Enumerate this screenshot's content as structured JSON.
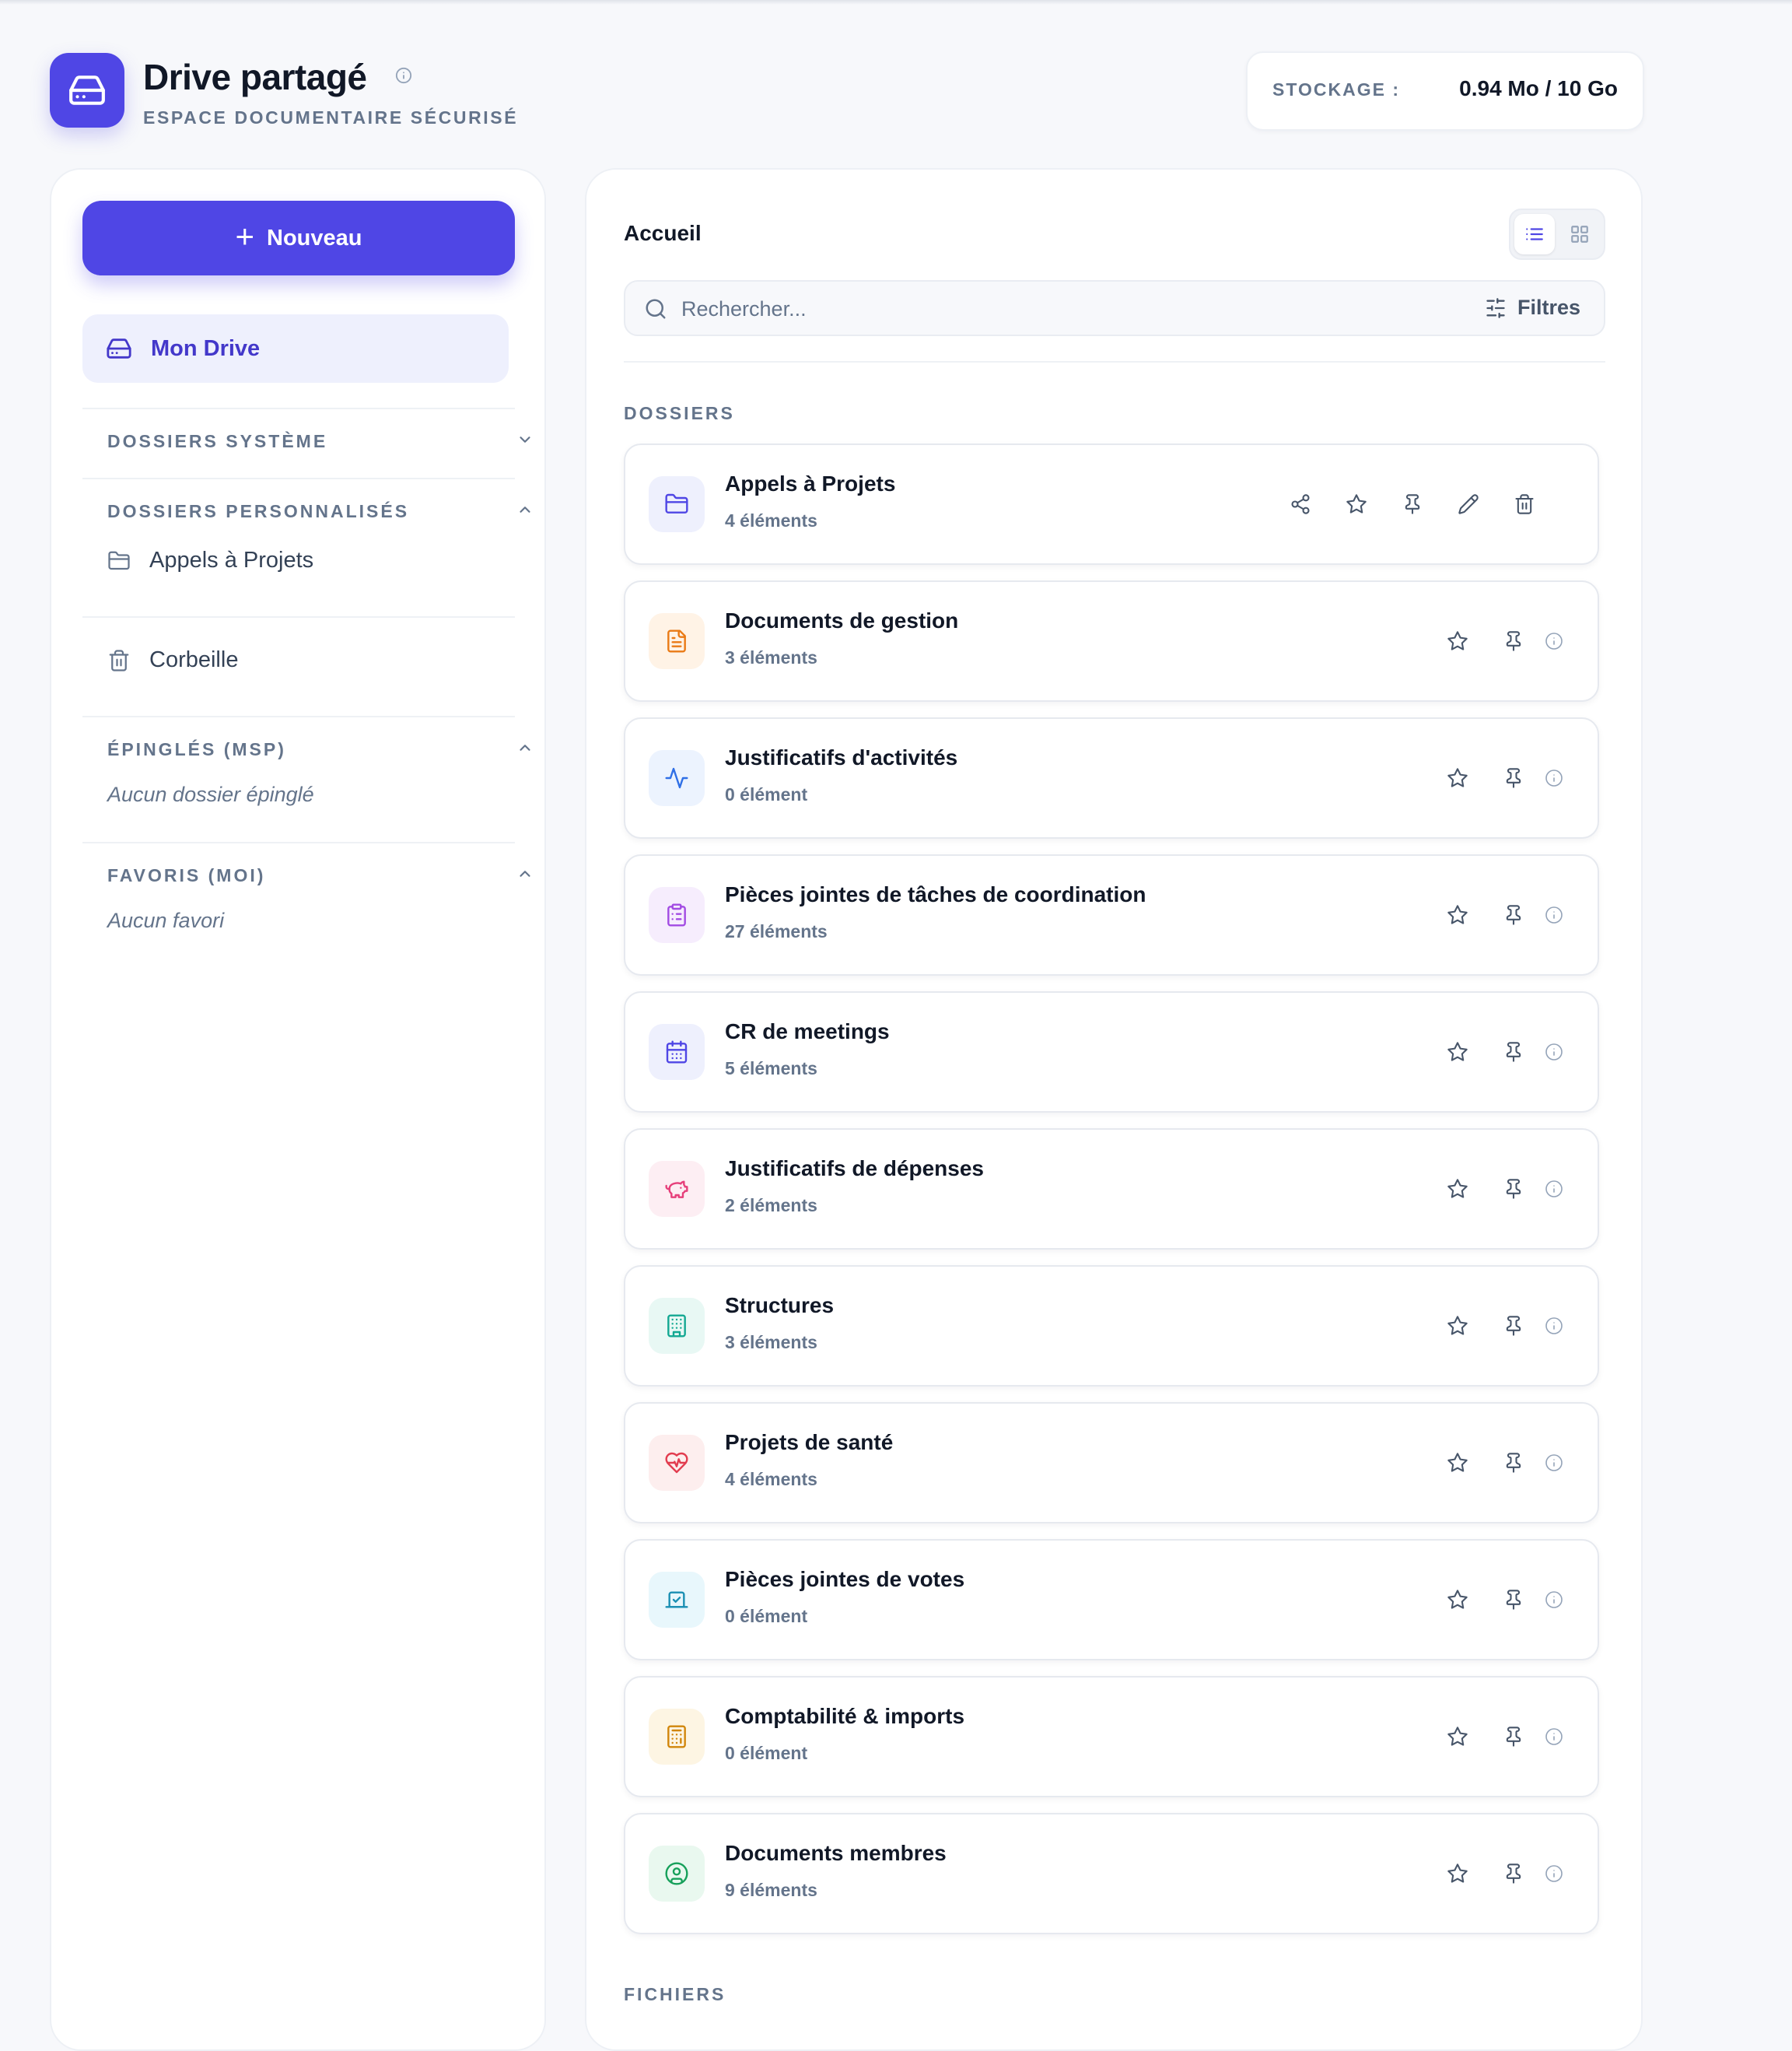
{
  "header": {
    "title": "Drive partagé",
    "subtitle": "ESPACE DOCUMENTAIRE SÉCURISÉ",
    "storage_label": "STOCKAGE :",
    "storage_value": "0.94 Mo / 10 Go"
  },
  "sidebar": {
    "new_button": "Nouveau",
    "my_drive": "Mon Drive",
    "system_folders": "DOSSIERS SYSTÈME",
    "custom_folders": "DOSSIERS PERSONNALISÉS",
    "custom_items": [
      "Appels à Projets"
    ],
    "trash": "Corbeille",
    "pinned_header": "ÉPINGLÉS (MSP)",
    "pinned_empty": "Aucun dossier épinglé",
    "favorites_header": "FAVORIS (MOI)",
    "favorites_empty": "Aucun favori"
  },
  "main": {
    "breadcrumb": "Accueil",
    "search_placeholder": "Rechercher...",
    "filters_label": "Filtres",
    "folders_header": "DOSSIERS",
    "files_header": "FICHIERS",
    "folders": [
      {
        "name": "Appels à Projets",
        "count": "4 éléments",
        "icon": "folder-icon",
        "color": "#4f46e5",
        "bg": "#eef0fd",
        "actions": [
          "share-icon",
          "star-icon",
          "pin-icon",
          "edit-icon",
          "trash-icon"
        ]
      },
      {
        "name": "Documents de gestion",
        "count": "3 éléments",
        "icon": "document-icon",
        "color": "#ea7a15",
        "bg": "#fff3e6",
        "actions": [
          "star-icon",
          "pin-icon",
          "info-icon"
        ]
      },
      {
        "name": "Justificatifs d'activités",
        "count": "0 élément",
        "icon": "activity-icon",
        "color": "#2f6fe6",
        "bg": "#ecf3fe",
        "actions": [
          "star-icon",
          "pin-icon",
          "info-icon"
        ]
      },
      {
        "name": "Pièces jointes de tâches de coordination",
        "count": "27 éléments",
        "icon": "clipboard-icon",
        "color": "#a24be3",
        "bg": "#f6edfd",
        "actions": [
          "star-icon",
          "pin-icon",
          "info-icon"
        ]
      },
      {
        "name": "CR de meetings",
        "count": "5 éléments",
        "icon": "calendar-icon",
        "color": "#4f46e5",
        "bg": "#eef0fd",
        "actions": [
          "star-icon",
          "pin-icon",
          "info-icon"
        ]
      },
      {
        "name": "Justificatifs de dépenses",
        "count": "2 éléments",
        "icon": "piggy-bank-icon",
        "color": "#e63f7a",
        "bg": "#fdeef3",
        "actions": [
          "star-icon",
          "pin-icon",
          "info-icon"
        ]
      },
      {
        "name": "Structures",
        "count": "3 éléments",
        "icon": "building-icon",
        "color": "#13a892",
        "bg": "#e8f8f4",
        "actions": [
          "star-icon",
          "pin-icon",
          "info-icon"
        ]
      },
      {
        "name": "Projets de santé",
        "count": "4 éléments",
        "icon": "heart-pulse-icon",
        "color": "#e23c4f",
        "bg": "#fdeeee",
        "actions": [
          "star-icon",
          "pin-icon",
          "info-icon"
        ]
      },
      {
        "name": "Pièces jointes de votes",
        "count": "0 élément",
        "icon": "vote-icon",
        "color": "#1a8fb3",
        "bg": "#e8f7fc",
        "actions": [
          "star-icon",
          "pin-icon",
          "info-icon"
        ]
      },
      {
        "name": "Comptabilité & imports",
        "count": "0 élément",
        "icon": "calculator-icon",
        "color": "#d1860b",
        "bg": "#fdf5e3",
        "actions": [
          "star-icon",
          "pin-icon",
          "info-icon"
        ]
      },
      {
        "name": "Documents membres",
        "count": "9 éléments",
        "icon": "user-circle-icon",
        "color": "#16a05a",
        "bg": "#e9f8ef",
        "actions": [
          "star-icon",
          "pin-icon",
          "info-icon"
        ]
      }
    ]
  },
  "colors": {
    "accent": "#4f46e5",
    "accent_soft": "#eef0fd",
    "text_muted": "#64748b",
    "background": "#f7f8fb"
  }
}
